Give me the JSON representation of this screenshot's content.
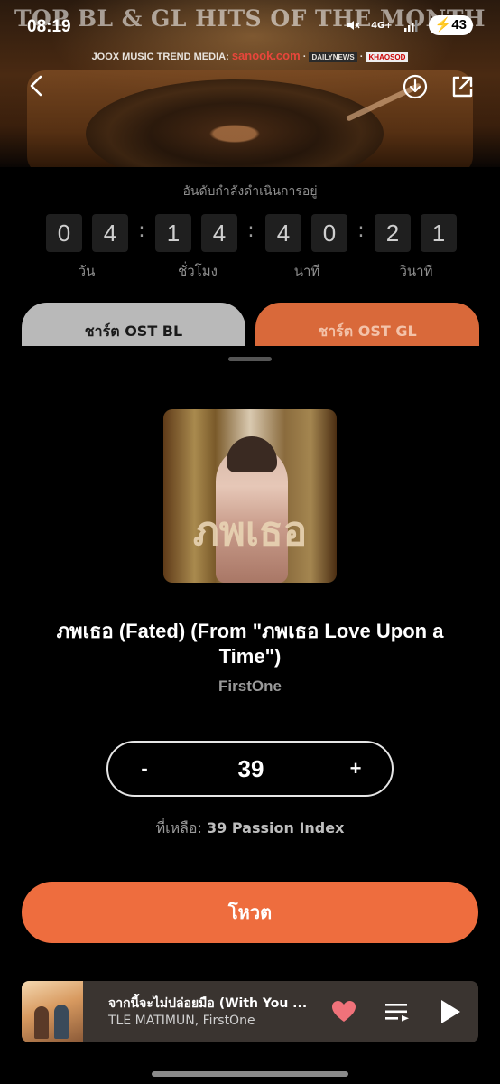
{
  "status_bar": {
    "time": "08:19",
    "network": "4G+",
    "battery": "43"
  },
  "hero": {
    "title": "TOP BL & GL HITS OF THE MONTH",
    "media_label": "JOOX MUSIC TREND MEDIA:",
    "media_brand": "sanook.com",
    "media_partner_1": "DAILYNEWS",
    "media_partner_2": "KHAOSOD"
  },
  "countdown": {
    "label": "อันดับกำลังดำเนินการอยู่",
    "days": [
      "0",
      "4"
    ],
    "hours": [
      "1",
      "4"
    ],
    "minutes": [
      "4",
      "0"
    ],
    "seconds": [
      "2",
      "1"
    ],
    "units": {
      "days": "วัน",
      "hours": "ชั่วโมง",
      "minutes": "นาที",
      "seconds": "วินาที"
    }
  },
  "tabs": {
    "bl": "ชาร์ต OST BL",
    "gl": "ชาร์ต OST GL"
  },
  "song": {
    "cover_text": "ภพเธอ",
    "title": "ภพเธอ (Fated) (From \"ภพเธอ Love Upon a Time\")",
    "artist": "FirstOne"
  },
  "vote": {
    "minus": "-",
    "plus": "+",
    "value": "39",
    "remaining_label": "ที่เหลือ:",
    "remaining_value": "39 Passion Index",
    "button_label": "โหวต"
  },
  "player": {
    "title": "จากนี้จะไม่ปล่อยมือ (With You ...",
    "artist": "TLE MATIMUN, FirstOne"
  },
  "colors": {
    "accent": "#ee6d3e",
    "tab_gl": "#d9693a",
    "tab_bl": "#b9b9b9",
    "heart": "#f0727a"
  },
  "icons": {
    "back": "chevron-left-icon",
    "download": "download-icon",
    "share": "share-icon",
    "heart": "heart-icon",
    "queue": "queue-icon",
    "play": "play-icon"
  }
}
